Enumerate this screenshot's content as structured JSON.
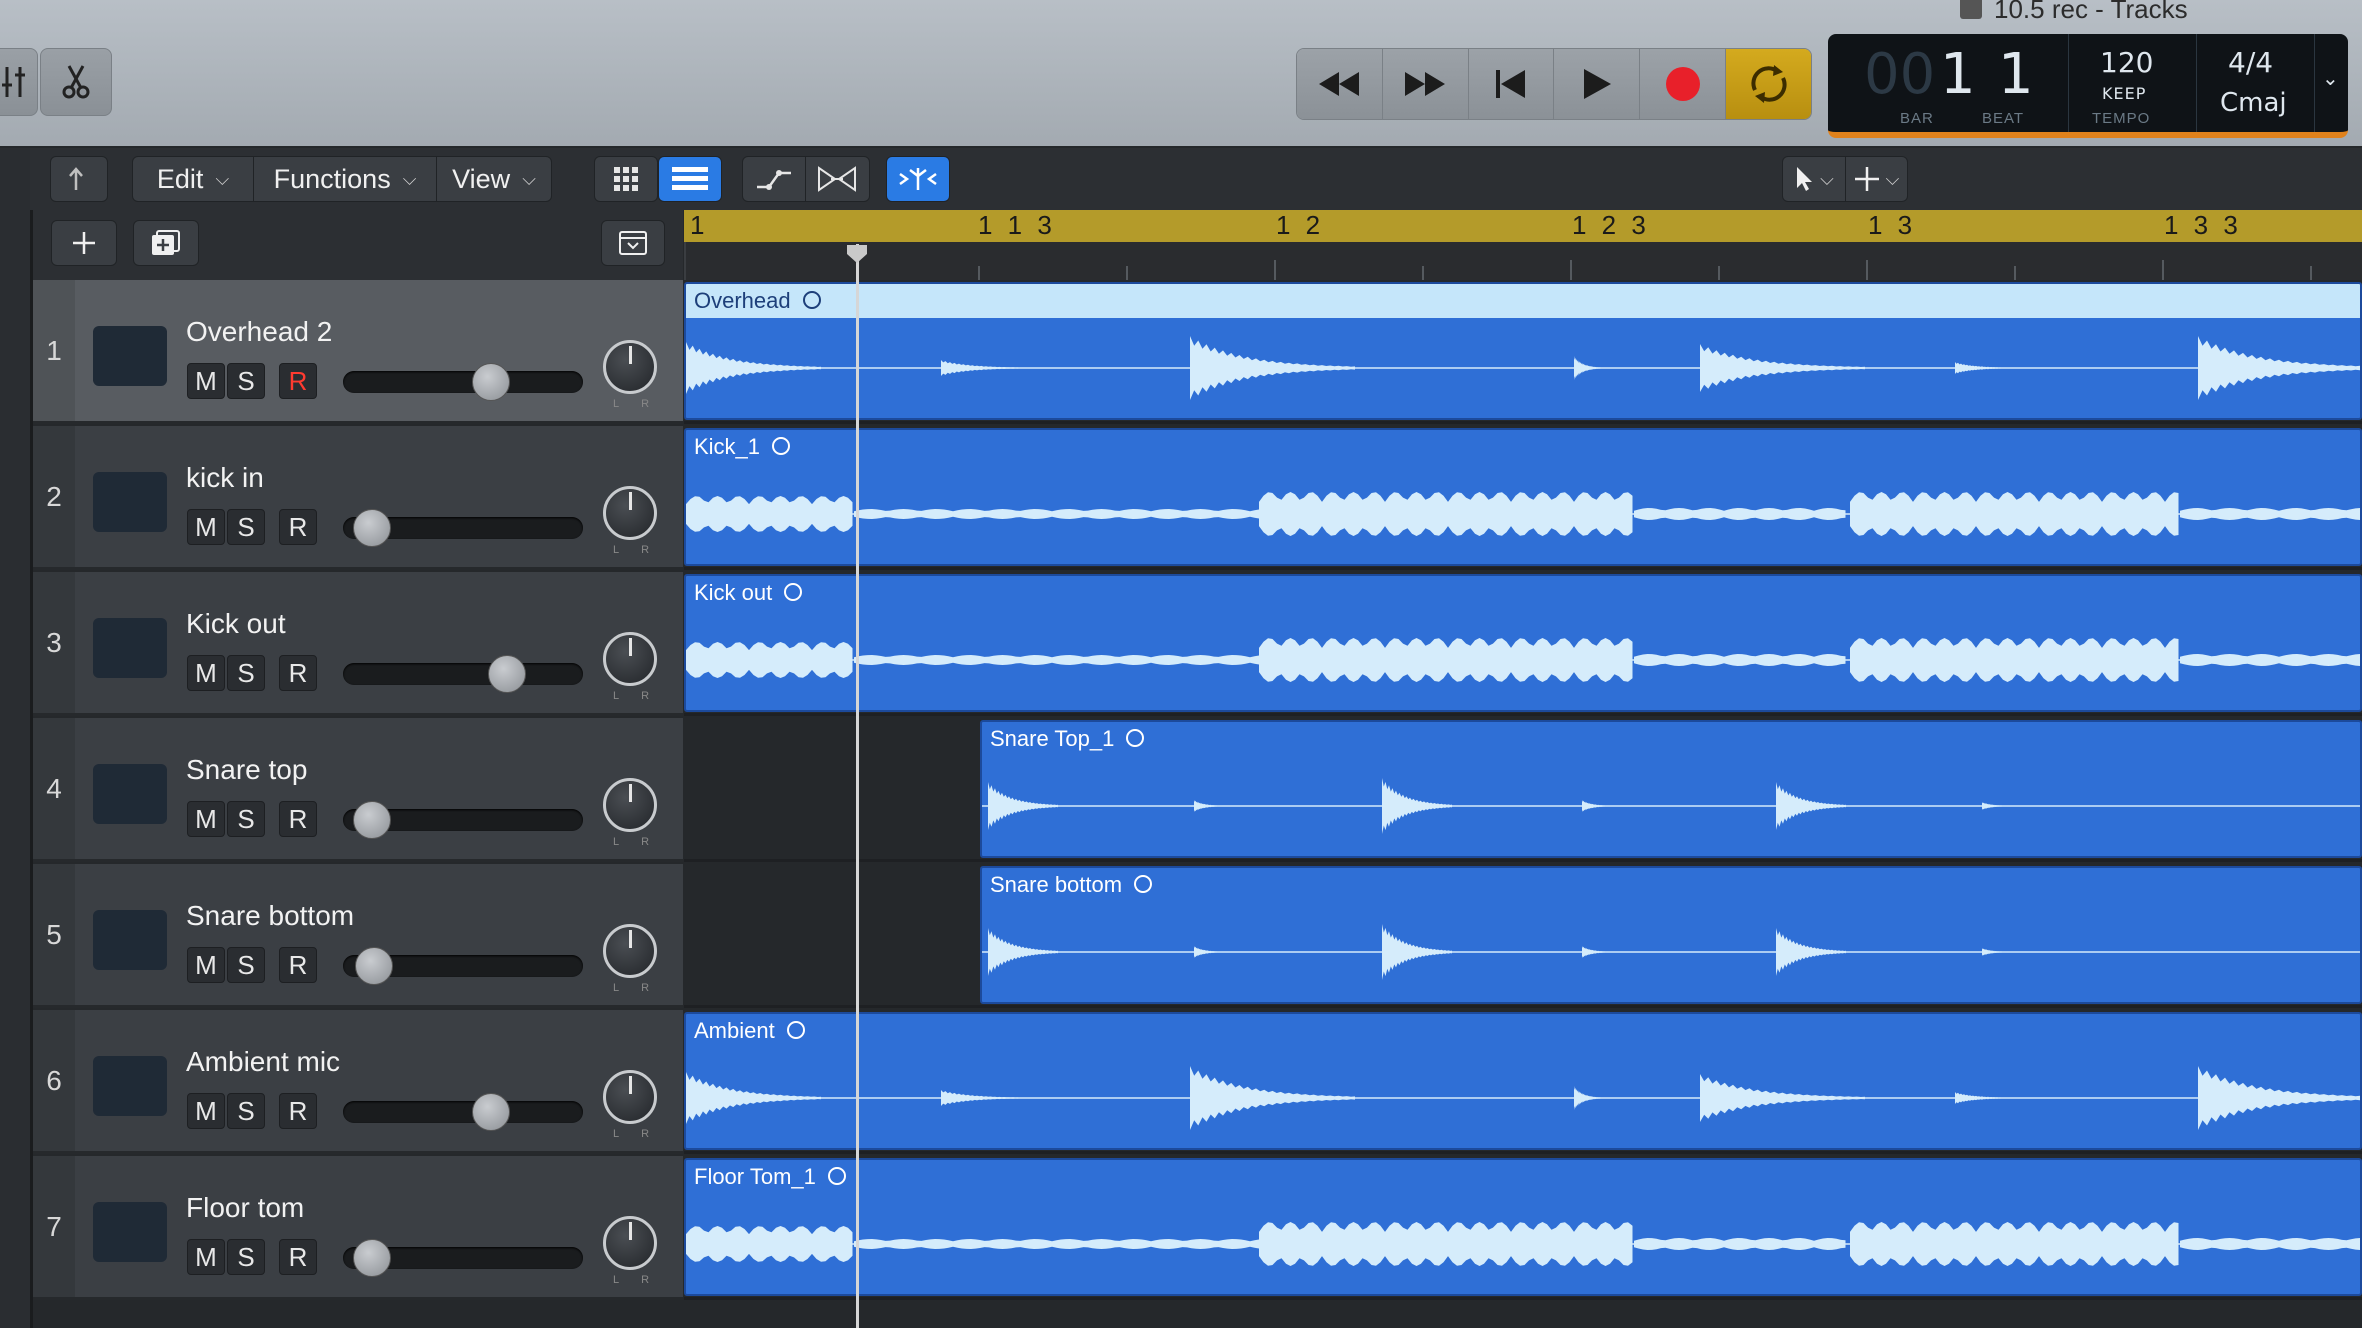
{
  "window": {
    "title": "10.5 rec - Tracks"
  },
  "controlbar": {
    "left_icons": [
      "mixer-icon",
      "scissors-icon"
    ],
    "transport": [
      "rewind-icon",
      "fast-forward-icon",
      "go-to-start-icon",
      "play-icon",
      "record-icon",
      "cycle-icon"
    ]
  },
  "lcd": {
    "bar_dim": "00",
    "bar": "1",
    "beat": "1",
    "bar_label": "BAR",
    "beat_label": "BEAT",
    "tempo": "120",
    "tempo_mode": "KEEP",
    "tempo_label": "TEMPO",
    "signature": "4/4",
    "key": "Cmaj"
  },
  "toolbar": {
    "edit": "Edit",
    "functions": "Functions",
    "view": "View"
  },
  "ruler": {
    "bars": [
      "1",
      "1 1 3",
      "1 2",
      "1 2 3",
      "1 3",
      "1 3 3"
    ],
    "color": "#b49b2a"
  },
  "buttons": {
    "mute": "M",
    "solo": "S",
    "record": "R",
    "pan_lr": "LR"
  },
  "tracks": [
    {
      "number": "1",
      "name": "Overhead 2",
      "region": "Overhead",
      "fader": 0.63,
      "selected": true,
      "rec_armed": true
    },
    {
      "number": "2",
      "name": "kick in",
      "region": "Kick_1",
      "fader": 0.05,
      "selected": false,
      "rec_armed": false
    },
    {
      "number": "3",
      "name": "Kick out",
      "region": "Kick out",
      "fader": 0.71,
      "selected": false,
      "rec_armed": false
    },
    {
      "number": "4",
      "name": "Snare top",
      "region": "Snare Top_1",
      "fader": 0.05,
      "selected": false,
      "rec_armed": false
    },
    {
      "number": "5",
      "name": "Snare bottom",
      "region": "Snare bottom",
      "fader": 0.06,
      "selected": false,
      "rec_armed": false
    },
    {
      "number": "6",
      "name": "Ambient mic",
      "region": "Ambient",
      "fader": 0.63,
      "selected": false,
      "rec_armed": false
    },
    {
      "number": "7",
      "name": "Floor tom",
      "region": "Floor Tom_1",
      "fader": 0.05,
      "selected": false,
      "rec_armed": false
    }
  ],
  "colors": {
    "region": "#2f6fd6",
    "waveform": "#d5ecfb",
    "record": "#e8202a",
    "cycle": "#d4aa1e",
    "lcd_accent": "#e0821c"
  }
}
